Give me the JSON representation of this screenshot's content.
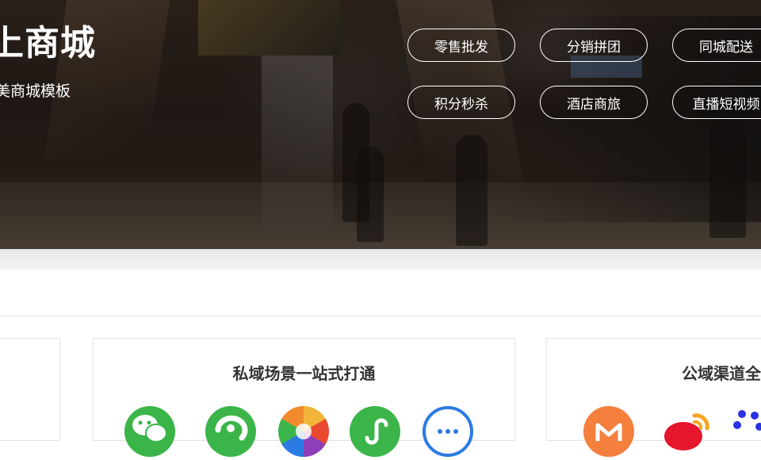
{
  "hero": {
    "title": "上商城",
    "subtitle": "美商城模板",
    "buttons": [
      {
        "label": "零售批发"
      },
      {
        "label": "分销拼团"
      },
      {
        "label": "同城配送"
      },
      {
        "label": "积分秒杀"
      },
      {
        "label": "酒店商旅"
      },
      {
        "label": "直播短视频"
      }
    ]
  },
  "cards": [
    {
      "title": ""
    },
    {
      "title": "私域场景一站式打通",
      "icons": [
        "wechat-icon",
        "wechat-pay-icon",
        "camera-aperture-icon",
        "mini-program-icon",
        "chat-bubble-icon"
      ]
    },
    {
      "title": "公域渠道全",
      "icons": [
        "meituan-icon",
        "weibo-icon",
        "baidu-icon"
      ]
    }
  ],
  "colors": {
    "pill_border": "#ffffff",
    "card_border": "#e3e3e3",
    "card_title": "#333333",
    "wechat_green": "#3bb54a",
    "chat_blue": "#2b7be4",
    "meituan_orange": "#f5803e",
    "weibo_red": "#e6162d",
    "baidu_blue": "#2932e1"
  }
}
